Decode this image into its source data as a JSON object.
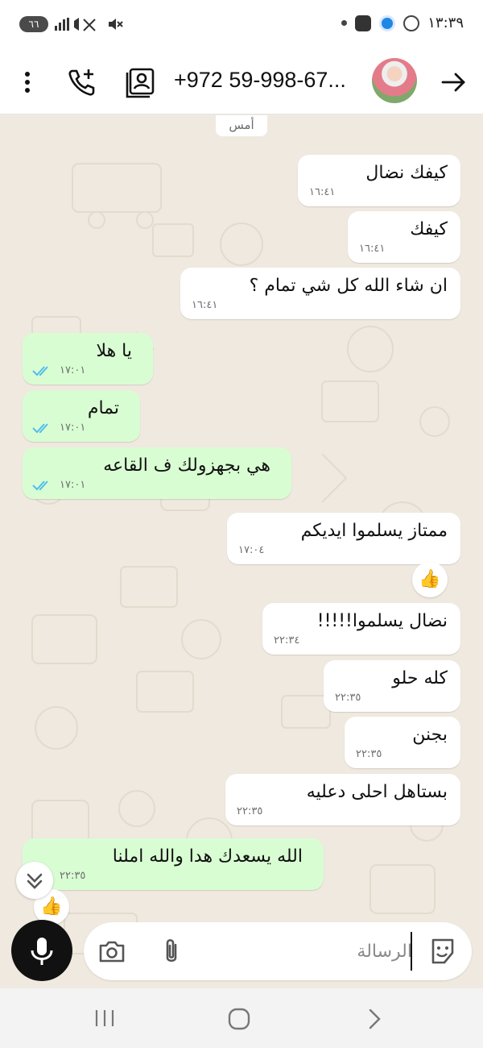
{
  "status_bar": {
    "battery": "٦٦",
    "time": "١٣:٣٩",
    "icons": [
      "signal-icon",
      "wifi-icon",
      "mute-icon",
      "dot-icon",
      "app-icon",
      "whatsapp-icon"
    ]
  },
  "header": {
    "title": "+972 59-998-67...",
    "icons": [
      "more-vert-icon",
      "add-call-icon",
      "contact-card-icon",
      "back-arrow-icon"
    ]
  },
  "chat": {
    "day_label": "أمس",
    "messages": [
      {
        "dir": "in",
        "text": "كيفك نضال",
        "time": "١٦:٤١"
      },
      {
        "dir": "in",
        "text": "كيفك",
        "time": "١٦:٤١"
      },
      {
        "dir": "in",
        "text": "ان شاء الله كل شي تمام ؟",
        "time": "١٦:٤١"
      },
      {
        "dir": "out",
        "text": "يا هلا",
        "time": "١٧:٠١",
        "read": true
      },
      {
        "dir": "out",
        "text": "تمام",
        "time": "١٧:٠١",
        "read": true
      },
      {
        "dir": "out",
        "text": "هي بجهزولك ف القاعه",
        "time": "١٧:٠١",
        "read": true
      },
      {
        "dir": "in",
        "text": "ممتاز يسلموا ايديكم",
        "time": "١٧:٠٤",
        "reaction": "👍"
      },
      {
        "dir": "in",
        "text": "نضال يسلموا!!!!!",
        "time": "٢٢:٣٤"
      },
      {
        "dir": "in",
        "text": "كله حلو",
        "time": "٢٢:٣٥"
      },
      {
        "dir": "in",
        "text": "بجنن",
        "time": "٢٢:٣٥"
      },
      {
        "dir": "in",
        "text": "بستاهل احلى دعليه",
        "time": "٢٢:٣٥"
      },
      {
        "dir": "out",
        "text": "الله يسعدك هدا والله املنا",
        "time": "٢٢:٣٥",
        "reaction": "👍"
      }
    ]
  },
  "composer": {
    "placeholder": "الرسالة",
    "value": ""
  },
  "colors": {
    "incoming_bubble": "#ffffff",
    "outgoing_bubble": "#d9fdd3",
    "read_ticks": "#53bdeb",
    "chat_background": "#efe9df"
  }
}
